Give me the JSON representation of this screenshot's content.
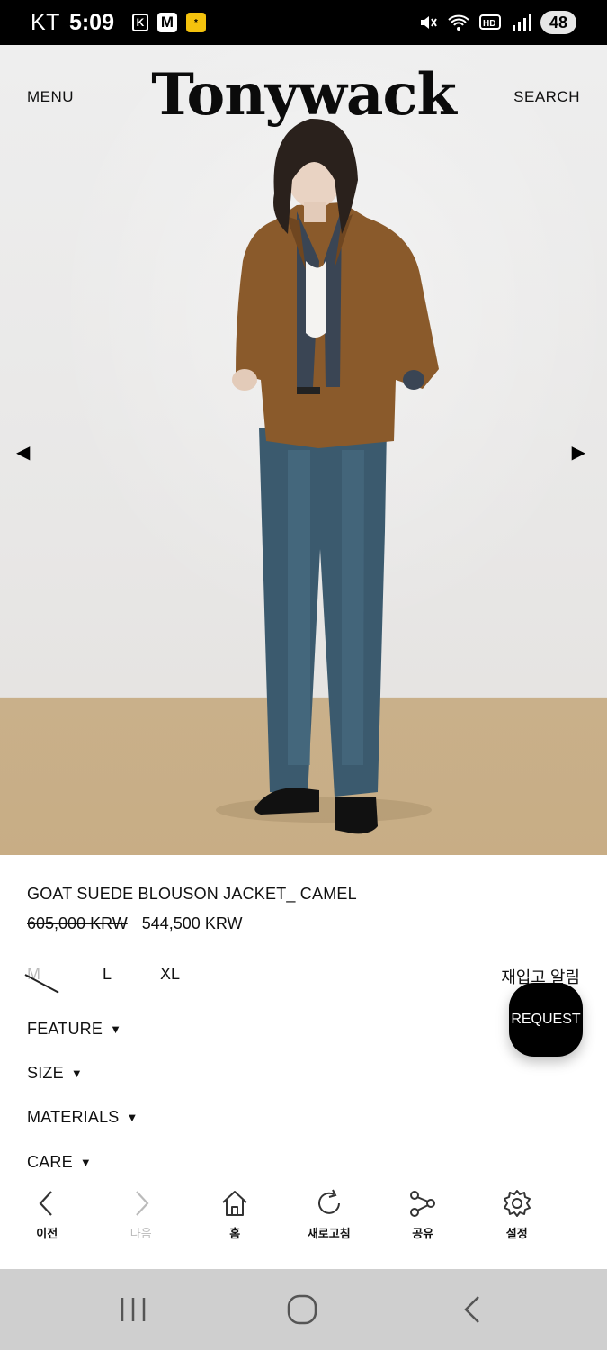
{
  "status_bar": {
    "carrier": "KT",
    "time": "5:09",
    "apps": [
      "K",
      "M",
      "*"
    ],
    "battery": "48"
  },
  "header": {
    "menu_label": "MENU",
    "brand": "Tonywack",
    "search_label": "SEARCH"
  },
  "product": {
    "name": "GOAT SUEDE BLOUSON JACKET_ CAMEL",
    "original_price": "605,000 KRW",
    "sale_price": "544,500 KRW",
    "sizes": [
      {
        "label": "M",
        "sold_out": true
      },
      {
        "label": "L",
        "sold_out": false
      },
      {
        "label": "XL",
        "sold_out": false
      }
    ],
    "restock_label": "재입고 알림",
    "sections": [
      "FEATURE",
      "SIZE",
      "MATERIALS",
      "CARE"
    ],
    "caret": "▼"
  },
  "request_button": "REQUEST",
  "toolbar": {
    "items": [
      {
        "label": "이전",
        "icon": "back-icon",
        "enabled": true
      },
      {
        "label": "다음",
        "icon": "forward-icon",
        "enabled": false
      },
      {
        "label": "홈",
        "icon": "home-icon",
        "enabled": true
      },
      {
        "label": "새로고침",
        "icon": "refresh-icon",
        "enabled": true
      },
      {
        "label": "공유",
        "icon": "share-icon",
        "enabled": true
      },
      {
        "label": "설정",
        "icon": "gear-icon",
        "enabled": true
      }
    ]
  },
  "colors": {
    "jacket": "#8a5a2b",
    "denim": "#3b5a6e",
    "floor": "#c8ad85",
    "wall": "#ebeae9"
  }
}
